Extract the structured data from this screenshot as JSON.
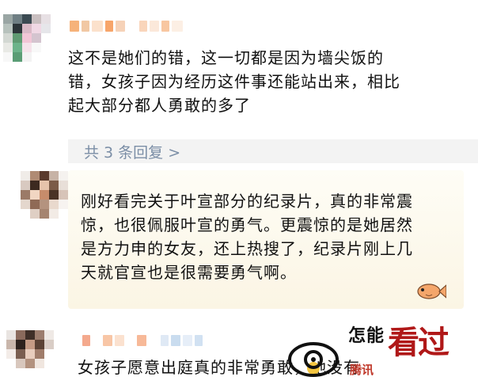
{
  "comments": [
    {
      "text": "这不是她们的错，这一切都是因为墙尖饭的\n错，女孩子因为经历这件事还能站出来，相比\n起大部分都人勇敢的多了",
      "replies_label": "共 3 条回复 >"
    },
    {
      "text": "刚好看完关于叶宣部分的纪录片，真的非常震\n惊，也很佩服叶宣的勇气。更震惊的是她居然\n是方力申的女友，还上热搜了，纪录片刚上几\n天就官宣也是很需要勇气啊。"
    },
    {
      "text": "女孩子愿意出庭真的非常勇敢，她没有"
    }
  ],
  "watermark": {
    "small_text": "怎能",
    "big_text": "看过",
    "red_text": "腾讯"
  },
  "colors": {
    "reply_link": "#7b8ea6",
    "card_bg": "#fbf5e4",
    "watermark_red": "#b01818"
  },
  "icons": {
    "card_decoration": "fish-icon",
    "watermark_logo": "eye-icon",
    "emoji": "emoji-face-icon"
  }
}
